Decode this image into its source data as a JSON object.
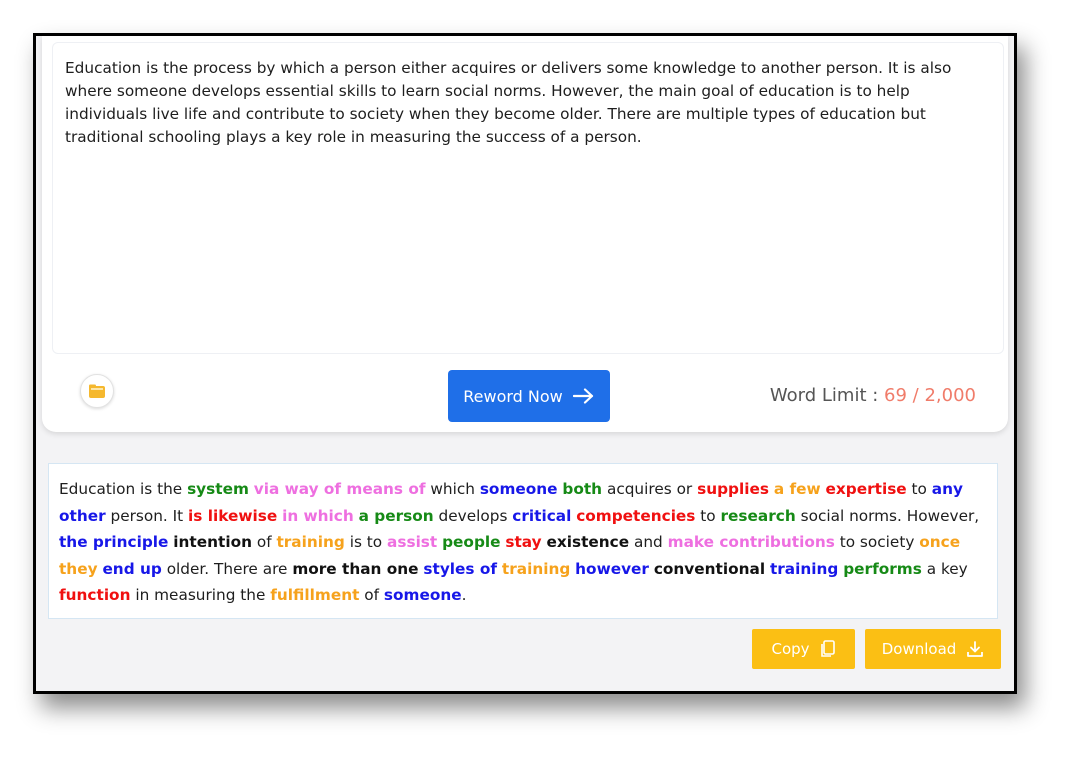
{
  "input": {
    "text": "Education is the process by which a person either acquires or delivers some knowledge to another person. It is also where someone develops essential skills to learn social norms. However, the main goal of education is to help individuals live life and contribute to society when they become older. There are multiple types of education but traditional schooling plays a key role in measuring the success of a person."
  },
  "toolbar": {
    "reword_label": "Reword Now",
    "word_limit_label": "Word Limit :",
    "word_count": "69 / 2,000"
  },
  "output": {
    "segments": [
      {
        "t": "Education is the ",
        "c": ""
      },
      {
        "t": "system",
        "c": "green"
      },
      {
        "t": " ",
        "c": ""
      },
      {
        "t": "via way of means of",
        "c": "pink"
      },
      {
        "t": " which ",
        "c": ""
      },
      {
        "t": "someone",
        "c": "blue"
      },
      {
        "t": " ",
        "c": ""
      },
      {
        "t": "both",
        "c": "green"
      },
      {
        "t": " acquires or ",
        "c": ""
      },
      {
        "t": "supplies",
        "c": "red"
      },
      {
        "t": " ",
        "c": ""
      },
      {
        "t": "a few",
        "c": "orange"
      },
      {
        "t": " ",
        "c": ""
      },
      {
        "t": "expertise",
        "c": "red"
      },
      {
        "t": " to ",
        "c": ""
      },
      {
        "t": "any other",
        "c": "blue"
      },
      {
        "t": " person. It ",
        "c": ""
      },
      {
        "t": "is likewise",
        "c": "red"
      },
      {
        "t": " ",
        "c": ""
      },
      {
        "t": "in which",
        "c": "pink"
      },
      {
        "t": " ",
        "c": ""
      },
      {
        "t": "a person",
        "c": "green"
      },
      {
        "t": " develops ",
        "c": ""
      },
      {
        "t": "critical",
        "c": "blue"
      },
      {
        "t": " ",
        "c": ""
      },
      {
        "t": "competencies",
        "c": "red"
      },
      {
        "t": " to ",
        "c": ""
      },
      {
        "t": "research",
        "c": "green"
      },
      {
        "t": " social norms. However, ",
        "c": ""
      },
      {
        "t": "the principle",
        "c": "blue"
      },
      {
        "t": " ",
        "c": ""
      },
      {
        "t": "intention",
        "c": "black"
      },
      {
        "t": " of ",
        "c": ""
      },
      {
        "t": "training",
        "c": "orange"
      },
      {
        "t": " is to ",
        "c": ""
      },
      {
        "t": "assist",
        "c": "pink"
      },
      {
        "t": " ",
        "c": ""
      },
      {
        "t": "people",
        "c": "green"
      },
      {
        "t": " ",
        "c": ""
      },
      {
        "t": "stay",
        "c": "red"
      },
      {
        "t": " ",
        "c": ""
      },
      {
        "t": "existence",
        "c": "black"
      },
      {
        "t": " and ",
        "c": ""
      },
      {
        "t": "make contributions",
        "c": "pink"
      },
      {
        "t": " to society ",
        "c": ""
      },
      {
        "t": "once they",
        "c": "orange"
      },
      {
        "t": " ",
        "c": ""
      },
      {
        "t": "end up",
        "c": "blue"
      },
      {
        "t": " older. There are ",
        "c": ""
      },
      {
        "t": "more than one",
        "c": "black"
      },
      {
        "t": " ",
        "c": ""
      },
      {
        "t": "styles of",
        "c": "blue"
      },
      {
        "t": " ",
        "c": ""
      },
      {
        "t": "training",
        "c": "orange"
      },
      {
        "t": " ",
        "c": ""
      },
      {
        "t": "however",
        "c": "blue"
      },
      {
        "t": " ",
        "c": ""
      },
      {
        "t": "conventional",
        "c": "black"
      },
      {
        "t": " ",
        "c": ""
      },
      {
        "t": "training",
        "c": "blue"
      },
      {
        "t": " ",
        "c": ""
      },
      {
        "t": "performs",
        "c": "green"
      },
      {
        "t": " a key ",
        "c": ""
      },
      {
        "t": "function",
        "c": "red"
      },
      {
        "t": " in measuring the ",
        "c": ""
      },
      {
        "t": "fulfillment",
        "c": "orange"
      },
      {
        "t": " of ",
        "c": ""
      },
      {
        "t": "someone",
        "c": "blue"
      },
      {
        "t": ".",
        "c": ""
      }
    ]
  },
  "actions": {
    "copy_label": "Copy",
    "download_label": "Download"
  },
  "colors": {
    "primary": "#1f6fe8",
    "yellow": "#fbbf14",
    "count": "#f07c6a"
  }
}
